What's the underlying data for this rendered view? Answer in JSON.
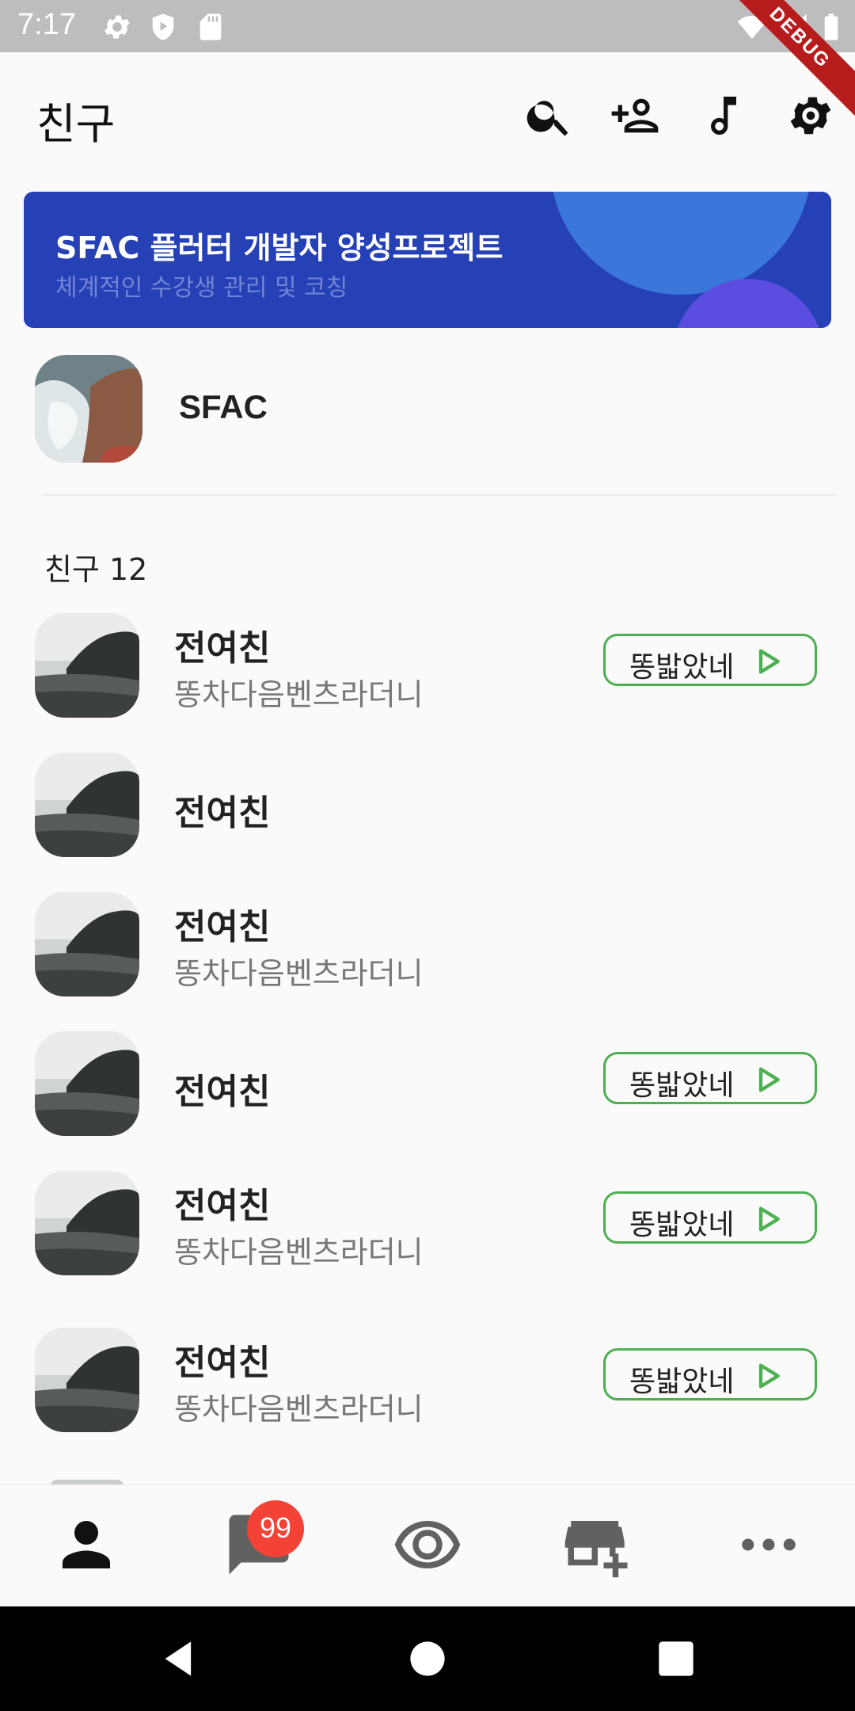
{
  "status_bar": {
    "time": "7:17",
    "debug_label": "DEBUG"
  },
  "app_bar": {
    "title": "친구"
  },
  "banner": {
    "title": "SFAC 플러터 개발자 양성프로젝트",
    "subtitle": "체계적인 수강생 관리 및 코칭"
  },
  "profile": {
    "name": "SFAC"
  },
  "friends_section": {
    "label": "친구 12"
  },
  "friends": [
    {
      "name": "전여친",
      "status": "똥차다음벤츠라더니",
      "music": "똥밟았네"
    },
    {
      "name": "전여친",
      "status": "",
      "music": ""
    },
    {
      "name": "전여친",
      "status": "똥차다음벤츠라더니",
      "music": ""
    },
    {
      "name": "전여친",
      "status": "",
      "music": "똥밟았네"
    },
    {
      "name": "전여친",
      "status": "똥차다음벤츠라더니",
      "music": "똥밟았네"
    },
    {
      "name": "전여친",
      "status": "똥차다음벤츠라더니",
      "music": "똥밟았네"
    }
  ],
  "bottom_nav": {
    "chat_badge": "99"
  },
  "colors": {
    "accent_green": "#4caf50",
    "banner_blue": "#2640b5",
    "badge_red": "#f44336"
  }
}
